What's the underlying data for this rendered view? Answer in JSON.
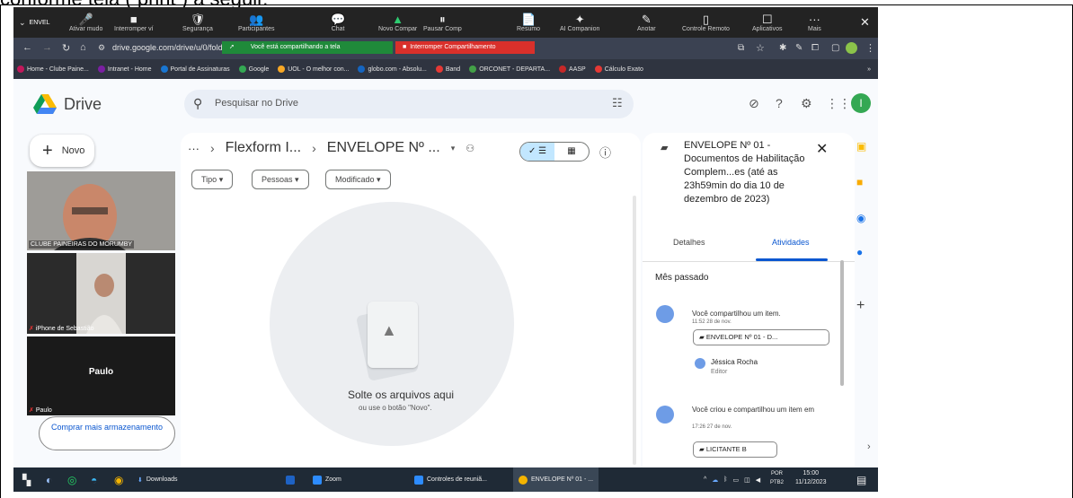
{
  "caption": "conforme tela ( print ) a seguir.",
  "zoom_toolbar": {
    "window_label": "ENVEL",
    "items": [
      {
        "icon": "🎤",
        "label": "Ativar mudo"
      },
      {
        "icon": "■",
        "label": "Interromper ví"
      },
      {
        "icon": "🛡",
        "label": "Segurança"
      },
      {
        "icon": "👥",
        "label": "Participantes"
      },
      {
        "icon": "💬",
        "label": "Chat"
      },
      {
        "icon": "▲",
        "label": "Novo Compar"
      },
      {
        "icon": "⏸",
        "label": "Pausar Comp"
      },
      {
        "icon": "📄",
        "label": "Resumo"
      },
      {
        "icon": "✦",
        "label": "AI Companion"
      },
      {
        "icon": "✎",
        "label": "Anotar"
      },
      {
        "icon": "▯",
        "label": "Controle Remoto"
      },
      {
        "icon": "☐",
        "label": "Aplicativos"
      },
      {
        "icon": "···",
        "label": "Mais"
      }
    ],
    "share_status": "Você está compartilhando a tela",
    "stop_share": "Interromper Compartilhamento"
  },
  "browser": {
    "url": "drive.google.com/drive/u/0/folders/1ho",
    "bookmarks": [
      {
        "label": "Home - Clube Paine...",
        "color": "#c2185b"
      },
      {
        "label": "Intranet - Home",
        "color": "#7b1fa2"
      },
      {
        "label": "Portal de Assinaturas",
        "color": "#1976d2"
      },
      {
        "label": "Google",
        "color": "#34a853"
      },
      {
        "label": "UOL - O melhor con...",
        "color": "#f9a825"
      },
      {
        "label": "globo.com - Absolu...",
        "color": "#1565c0"
      },
      {
        "label": "Band",
        "color": "#e53935"
      },
      {
        "label": "ORCONET - DEPARTA...",
        "color": "#43a047"
      },
      {
        "label": "AASP",
        "color": "#c62828"
      },
      {
        "label": "Cálculo Exato",
        "color": "#e53935"
      }
    ]
  },
  "drive": {
    "app_name": "Drive",
    "search_placeholder": "Pesquisar no Drive",
    "avatar_letter": "I",
    "new_button": "Novo",
    "buy_storage": "Comprar mais armazenamento",
    "breadcrumb_more": "···",
    "breadcrumb_parent": "Flexform I...",
    "breadcrumb_current": "ENVELOPE Nº ...",
    "filters": [
      "Tipo",
      "Pessoas",
      "Modificado"
    ],
    "empty_title": "Solte os arquivos aqui",
    "empty_sub": "ou use o botão \"Novo\"."
  },
  "meeting_tiles": [
    {
      "name": "CLUBE PAINEIRAS DO MORUMBY"
    },
    {
      "name": "iPhone de Sebastião"
    },
    {
      "name": "Paulo",
      "caption": "Paulo"
    }
  ],
  "details": {
    "title": "ENVELOPE Nº 01 - Documentos de Habilitação Complem...es (até as 23h59min do dia 10 de dezembro de 2023)",
    "tab_details": "Detalhes",
    "tab_activity": "Atividades",
    "period": "Mês passado",
    "activities": [
      {
        "text": "Você compartilhou um item.",
        "time": "11:52 28 de nov.",
        "chip": "ENVELOPE Nº 01 - D..."
      },
      {
        "text": "Você criou e compartilhou um item em",
        "time": "17:26 27 de nov.",
        "chip": "LICITANTE B"
      }
    ],
    "person_name": "Jéssica Rocha",
    "person_role": "Editor"
  },
  "taskbar": {
    "downloads": "Downloads",
    "zoom": "Zoom",
    "zoom_controls": "Controles de reuniã...",
    "chrome_tab": "ENVELOPE Nº 01 - ...",
    "lang": "POR",
    "lang2": "PTB2",
    "time": "15:00",
    "date": "11/12/2023"
  }
}
